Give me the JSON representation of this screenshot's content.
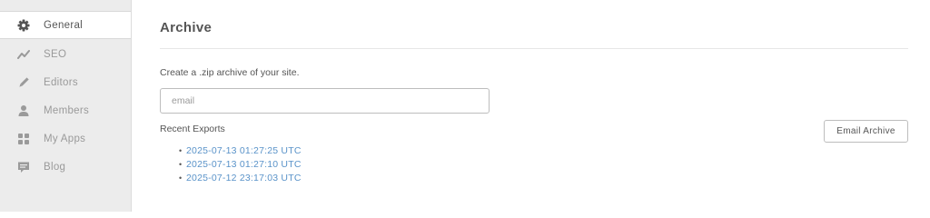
{
  "sidebar": {
    "items": [
      {
        "label": "General",
        "icon": "gear-icon",
        "active": true
      },
      {
        "label": "SEO",
        "icon": "trend-icon",
        "active": false
      },
      {
        "label": "Editors",
        "icon": "pencil-icon",
        "active": false
      },
      {
        "label": "Members",
        "icon": "person-icon",
        "active": false
      },
      {
        "label": "My Apps",
        "icon": "apps-grid-icon",
        "active": false
      },
      {
        "label": "Blog",
        "icon": "chat-icon",
        "active": false
      }
    ]
  },
  "main": {
    "title": "Archive",
    "description": "Create a .zip archive of your site.",
    "email_placeholder": "email",
    "email_value": "",
    "recent_label": "Recent Exports",
    "exports": [
      "2025-07-13 01:27:25 UTC",
      "2025-07-13 01:27:10 UTC",
      "2025-07-12 23:17:03 UTC"
    ],
    "email_button_label": "Email Archive"
  },
  "colors": {
    "link": "#5a93c9",
    "sidebar_bg": "#ececec",
    "icon": "#9a9a9a",
    "icon_active": "#555555"
  }
}
